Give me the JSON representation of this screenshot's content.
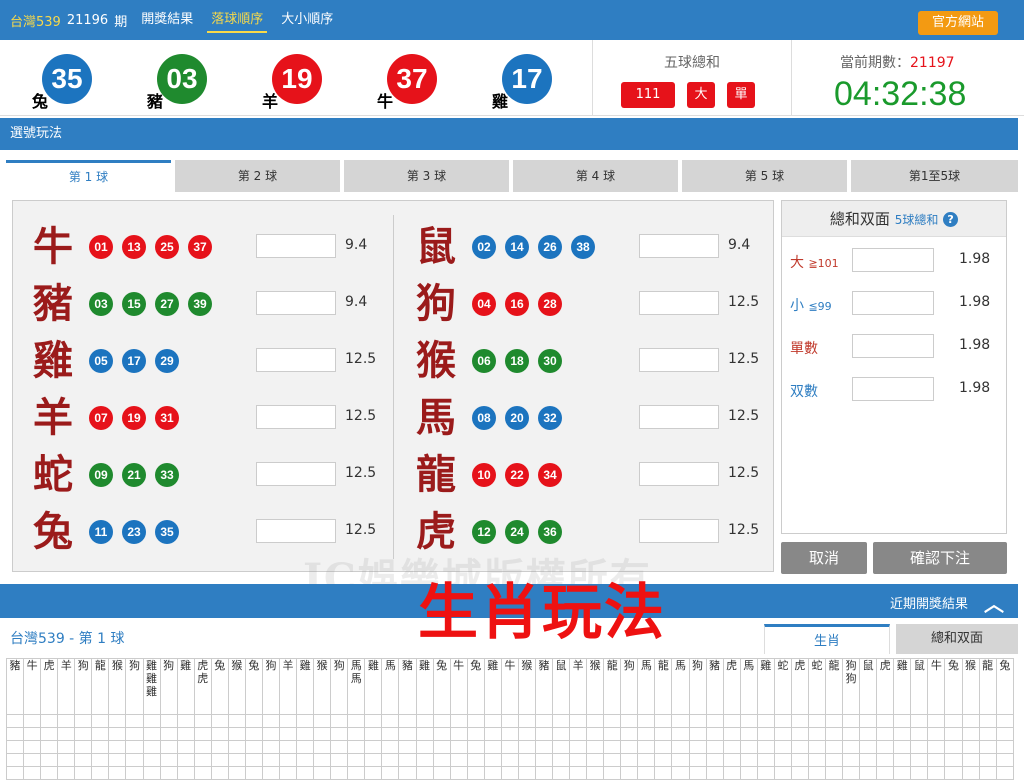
{
  "topbar": {
    "lottery": "台灣539",
    "period": "21196",
    "period_unit": "期",
    "tab_results": "開獎結果",
    "tab_drop_order": "落球順序",
    "tab_size_order": "大小順序",
    "official_site": "官方網站"
  },
  "draw": {
    "balls": [
      {
        "number": "35",
        "zodiac": "兔",
        "color": "blue"
      },
      {
        "number": "03",
        "zodiac": "豬",
        "color": "green"
      },
      {
        "number": "19",
        "zodiac": "羊",
        "color": "red"
      },
      {
        "number": "37",
        "zodiac": "牛",
        "color": "red"
      },
      {
        "number": "17",
        "zodiac": "雞",
        "color": "blue"
      }
    ],
    "sum_title": "五球總和",
    "sum_value": "111",
    "size_tag": "大",
    "parity_tag": "單",
    "current_label": "當前期數：",
    "current_period": "21197",
    "countdown": "04:32:38"
  },
  "play": {
    "bar_label": "選號玩法",
    "tabs": [
      "第 1 球",
      "第 2 球",
      "第 3 球",
      "第 4 球",
      "第 5 球",
      "第1至5球"
    ],
    "active_tab": 0
  },
  "zodiac_left": [
    {
      "name": "牛",
      "balls": [
        [
          "01",
          "red"
        ],
        [
          "13",
          "red"
        ],
        [
          "25",
          "red"
        ],
        [
          "37",
          "red"
        ]
      ],
      "odds": "9.4"
    },
    {
      "name": "豬",
      "balls": [
        [
          "03",
          "green"
        ],
        [
          "15",
          "green"
        ],
        [
          "27",
          "green"
        ],
        [
          "39",
          "green"
        ]
      ],
      "odds": "9.4"
    },
    {
      "name": "雞",
      "balls": [
        [
          "05",
          "blue"
        ],
        [
          "17",
          "blue"
        ],
        [
          "29",
          "blue"
        ]
      ],
      "odds": "12.5"
    },
    {
      "name": "羊",
      "balls": [
        [
          "07",
          "red"
        ],
        [
          "19",
          "red"
        ],
        [
          "31",
          "red"
        ]
      ],
      "odds": "12.5"
    },
    {
      "name": "蛇",
      "balls": [
        [
          "09",
          "green"
        ],
        [
          "21",
          "green"
        ],
        [
          "33",
          "green"
        ]
      ],
      "odds": "12.5"
    },
    {
      "name": "兔",
      "balls": [
        [
          "11",
          "blue"
        ],
        [
          "23",
          "blue"
        ],
        [
          "35",
          "blue"
        ]
      ],
      "odds": "12.5"
    }
  ],
  "zodiac_right": [
    {
      "name": "鼠",
      "balls": [
        [
          "02",
          "blue"
        ],
        [
          "14",
          "blue"
        ],
        [
          "26",
          "blue"
        ],
        [
          "38",
          "blue"
        ]
      ],
      "odds": "9.4"
    },
    {
      "name": "狗",
      "balls": [
        [
          "04",
          "red"
        ],
        [
          "16",
          "red"
        ],
        [
          "28",
          "red"
        ]
      ],
      "odds": "12.5"
    },
    {
      "name": "猴",
      "balls": [
        [
          "06",
          "green"
        ],
        [
          "18",
          "green"
        ],
        [
          "30",
          "green"
        ]
      ],
      "odds": "12.5"
    },
    {
      "name": "馬",
      "balls": [
        [
          "08",
          "blue"
        ],
        [
          "20",
          "blue"
        ],
        [
          "32",
          "blue"
        ]
      ],
      "odds": "12.5"
    },
    {
      "name": "龍",
      "balls": [
        [
          "10",
          "red"
        ],
        [
          "22",
          "red"
        ],
        [
          "34",
          "red"
        ]
      ],
      "odds": "12.5"
    },
    {
      "name": "虎",
      "balls": [
        [
          "12",
          "green"
        ],
        [
          "24",
          "green"
        ],
        [
          "36",
          "green"
        ]
      ],
      "odds": "12.5"
    }
  ],
  "watermark": "JC娛樂城版權所有",
  "side": {
    "title": "總和双面",
    "subtitle": "5球總和",
    "help_icon": "?",
    "rows": [
      {
        "label": "大",
        "sub": "≧101",
        "odds": "1.98",
        "color": "#c0392b"
      },
      {
        "label": "小",
        "sub": "≦99",
        "odds": "1.98",
        "color": "#2f7ec2"
      },
      {
        "label": "單數",
        "sub": "",
        "odds": "1.98",
        "color": "#c0392b"
      },
      {
        "label": "双數",
        "sub": "",
        "odds": "1.98",
        "color": "#2f7ec2"
      }
    ],
    "cancel": "取消",
    "confirm": "確認下注"
  },
  "overlay_title": "生肖玩法",
  "recent": {
    "label": "近期開獎結果",
    "subtitle": "台灣539 - 第 1 球",
    "tab_zodiac": "生肖",
    "tab_sum": "總和双面",
    "history": [
      "豬",
      "牛",
      "虎",
      "羊",
      "狗",
      "龍",
      "猴",
      "狗",
      "雞\n雞\n雞",
      "狗",
      "雞",
      "虎\n虎",
      "兔",
      "猴",
      "兔",
      "狗",
      "羊",
      "雞",
      "猴",
      "狗",
      "馬\n馬",
      "雞",
      "馬",
      "豬",
      "雞",
      "兔",
      "牛",
      "兔",
      "雞",
      "牛",
      "猴",
      "豬",
      "鼠",
      "羊",
      "猴",
      "龍",
      "狗",
      "馬",
      "龍",
      "馬",
      "狗",
      "豬",
      "虎",
      "馬",
      "雞",
      "蛇",
      "虎",
      "蛇",
      "龍",
      "狗\n狗",
      "鼠",
      "虎",
      "雞",
      "鼠",
      "牛",
      "兔",
      "猴",
      "龍",
      "兔"
    ]
  },
  "colors": {
    "blue": "#1c74bf",
    "green": "#1f8a2e",
    "red": "#e6121a",
    "accent": "#2f7ec2",
    "orange": "#f39a12"
  }
}
